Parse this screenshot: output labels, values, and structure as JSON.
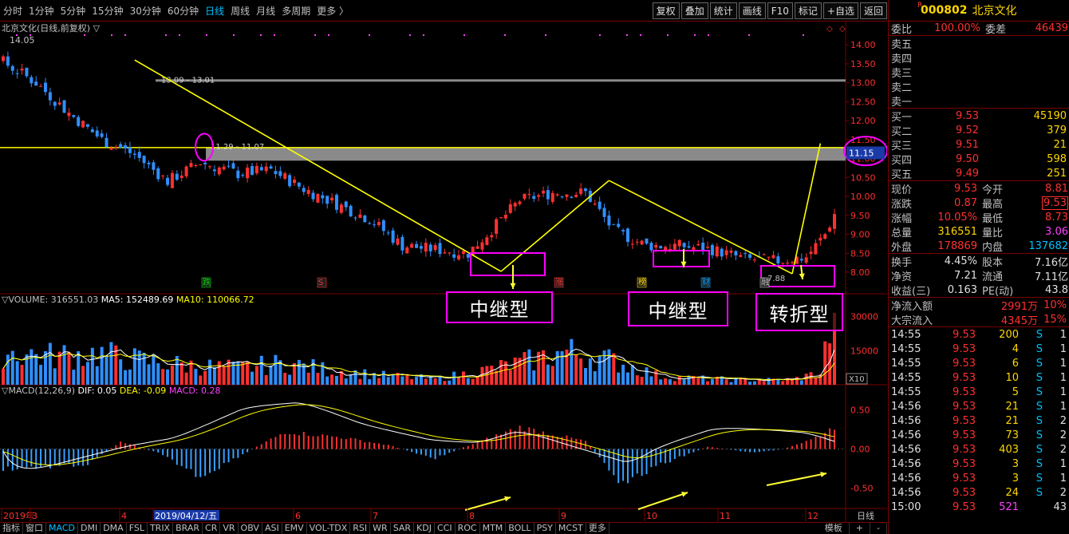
{
  "topbar": {
    "periods": [
      "分时",
      "1分钟",
      "5分钟",
      "15分钟",
      "30分钟",
      "60分钟",
      "日线",
      "周线",
      "月线",
      "多周期",
      "更多 〉"
    ],
    "active_period": "日线",
    "tools": [
      "复权",
      "叠加",
      "统计",
      "画线",
      "F10",
      "标记",
      "+自选",
      "返回"
    ]
  },
  "chart": {
    "header_text": "北京文化(日线,前复权) ▽",
    "high_label": "14.05",
    "low_label": "7.88",
    "y_axis_ticks": [
      "14.00",
      "13.50",
      "13.00",
      "12.50",
      "12.00",
      "11.50",
      "11.00",
      "10.50",
      "10.00",
      "9.50",
      "9.00",
      "8.50",
      "8.00"
    ],
    "current_price_tag": "11.15",
    "zone1_label": "13.09 - 13.01",
    "zone2_label": "11.29 - 11.07",
    "event_markers": [
      {
        "label": "跌",
        "color": "#00d000"
      },
      {
        "label": "S",
        "color": "#ff3030"
      },
      {
        "label": "涨",
        "color": "#ff3030"
      },
      {
        "label": "榜",
        "color": "#ffd700"
      },
      {
        "label": "财",
        "color": "#00a0ff"
      },
      {
        "label": "融",
        "color": "#c0c0c0"
      }
    ],
    "diamond_markers": [
      "◇",
      "◇"
    ],
    "annotations": [
      "中继型",
      "中继型",
      "转折型"
    ]
  },
  "volume": {
    "header": "VOLUME: 316551.03",
    "ma5": "MA5: 152489.69",
    "ma10": "MA10: 110066.72",
    "y_axis_ticks": [
      "30000",
      "15000"
    ],
    "unit_tag": "X10"
  },
  "macd": {
    "header": "MACD(12,26,9)",
    "dif": "DIF: 0.05",
    "dea": "DEA: -0.09",
    "macd": "MACD: 0.28",
    "y_axis_ticks": [
      "0.50",
      "0.00",
      "-0.50"
    ]
  },
  "x_axis": {
    "labels": [
      "2019年",
      "3",
      "4",
      "2019/04/12/五",
      "6",
      "7",
      "8",
      "9",
      "10",
      "11",
      "12"
    ],
    "period_label": "日线"
  },
  "bottom_tabs": {
    "items": [
      "指标",
      "窗口",
      "MACD",
      "DMI",
      "DMA",
      "FSL",
      "TRIX",
      "BRAR",
      "CR",
      "VR",
      "OBV",
      "ASI",
      "EMV",
      "VOL-TDX",
      "RSI",
      "WR",
      "SAR",
      "KDJ",
      "CCI",
      "ROC",
      "MTM",
      "BOLL",
      "PSY",
      "MCST",
      "更多"
    ],
    "active": "MACD",
    "right_items": [
      "模板",
      "+",
      "-"
    ]
  },
  "panel": {
    "flag": "R",
    "code": "000802",
    "name": "北京文化",
    "weibi_label": "委比",
    "weibi_value": "100.00%",
    "weicha_label": "委差",
    "weicha_value": "46439",
    "asks": [
      {
        "label": "卖五",
        "price": "",
        "vol": ""
      },
      {
        "label": "卖四",
        "price": "",
        "vol": ""
      },
      {
        "label": "卖三",
        "price": "",
        "vol": ""
      },
      {
        "label": "卖二",
        "price": "",
        "vol": ""
      },
      {
        "label": "卖一",
        "price": "",
        "vol": ""
      }
    ],
    "bids": [
      {
        "label": "买一",
        "price": "9.53",
        "vol": "45190"
      },
      {
        "label": "买二",
        "price": "9.52",
        "vol": "379"
      },
      {
        "label": "买三",
        "price": "9.51",
        "vol": "21"
      },
      {
        "label": "买四",
        "price": "9.50",
        "vol": "598"
      },
      {
        "label": "买五",
        "price": "9.49",
        "vol": "251"
      }
    ],
    "stats": [
      {
        "l1": "现价",
        "v1": "9.53",
        "c1": "red",
        "l2": "今开",
        "v2": "8.81",
        "c2": "red"
      },
      {
        "l1": "涨跌",
        "v1": "0.87",
        "c1": "red",
        "l2": "最高",
        "v2": "9.53",
        "c2": "red"
      },
      {
        "l1": "涨幅",
        "v1": "10.05%",
        "c1": "red",
        "l2": "最低",
        "v2": "8.73",
        "c2": "red"
      },
      {
        "l1": "总量",
        "v1": "316551",
        "c1": "yel",
        "l2": "量比",
        "v2": "3.06",
        "c2": "mag"
      },
      {
        "l1": "外盘",
        "v1": "178869",
        "c1": "red",
        "l2": "内盘",
        "v2": "137682",
        "c2": "cyan"
      }
    ],
    "stats2": [
      {
        "l1": "换手",
        "v1": "4.45%",
        "l2": "股本",
        "v2": "7.16亿"
      },
      {
        "l1": "净资",
        "v1": "7.21",
        "l2": "流通",
        "v2": "7.11亿"
      },
      {
        "l1": "收益(三)",
        "v1": "0.163",
        "l2": "PE(动)",
        "v2": "43.8"
      }
    ],
    "flows": [
      {
        "label": "净流入额",
        "value": "2991万",
        "pct": "10%"
      },
      {
        "label": "大宗流入",
        "value": "4345万",
        "pct": "15%"
      }
    ],
    "ticks": [
      {
        "time": "14:55",
        "price": "9.53",
        "vol": "200",
        "vc": "yel",
        "side": "S",
        "n": "1"
      },
      {
        "time": "14:55",
        "price": "9.53",
        "vol": "4",
        "vc": "yel",
        "side": "S",
        "n": "1"
      },
      {
        "time": "14:55",
        "price": "9.53",
        "vol": "6",
        "vc": "yel",
        "side": "S",
        "n": "1"
      },
      {
        "time": "14:55",
        "price": "9.53",
        "vol": "10",
        "vc": "yel",
        "side": "S",
        "n": "1"
      },
      {
        "time": "14:55",
        "price": "9.53",
        "vol": "5",
        "vc": "yel",
        "side": "S",
        "n": "1"
      },
      {
        "time": "14:56",
        "price": "9.53",
        "vol": "21",
        "vc": "yel",
        "side": "S",
        "n": "1"
      },
      {
        "time": "14:56",
        "price": "9.53",
        "vol": "21",
        "vc": "yel",
        "side": "S",
        "n": "2"
      },
      {
        "time": "14:56",
        "price": "9.53",
        "vol": "73",
        "vc": "yel",
        "side": "S",
        "n": "2"
      },
      {
        "time": "14:56",
        "price": "9.53",
        "vol": "403",
        "vc": "yel",
        "side": "S",
        "n": "2"
      },
      {
        "time": "14:56",
        "price": "9.53",
        "vol": "3",
        "vc": "yel",
        "side": "S",
        "n": "1"
      },
      {
        "time": "14:56",
        "price": "9.53",
        "vol": "3",
        "vc": "yel",
        "side": "S",
        "n": "1"
      },
      {
        "time": "14:56",
        "price": "9.53",
        "vol": "24",
        "vc": "yel",
        "side": "S",
        "n": "2"
      },
      {
        "time": "15:00",
        "price": "9.53",
        "vol": "521",
        "vc": "mag",
        "side": "",
        "n": "43"
      }
    ]
  },
  "chart_data": {
    "type": "candlestick",
    "colors": {
      "up": "#ff3030",
      "down": "#2f8fff",
      "ma5": "#ffffff",
      "ma10": "#ffff00",
      "trendline": "#ffff00",
      "highlight": "#ff00ff"
    },
    "price_range": [
      7.6,
      14.3
    ],
    "volume_range": [
      0,
      33000
    ],
    "macd_range": [
      -0.72,
      0.72
    ],
    "trend_path": [
      [
        0,
        13.55
      ],
      [
        7,
        13.0
      ],
      [
        14,
        12.2
      ],
      [
        21,
        11.5
      ],
      [
        28,
        11.1
      ],
      [
        35,
        10.4
      ],
      [
        42,
        10.9
      ],
      [
        50,
        10.6
      ],
      [
        57,
        10.7
      ],
      [
        64,
        10.2
      ],
      [
        71,
        9.8
      ],
      [
        78,
        9.4
      ],
      [
        85,
        8.7
      ],
      [
        92,
        8.6
      ],
      [
        99,
        8.5
      ],
      [
        103,
        9.0
      ],
      [
        110,
        9.9
      ],
      [
        117,
        10.1
      ],
      [
        124,
        10.1
      ],
      [
        130,
        9.1
      ],
      [
        137,
        8.7
      ],
      [
        144,
        8.7
      ],
      [
        151,
        8.6
      ],
      [
        158,
        8.35
      ],
      [
        165,
        8.3
      ],
      [
        171,
        8.4
      ],
      [
        175,
        9.0
      ],
      [
        177,
        9.53
      ]
    ],
    "macd_hist_path": [
      [
        0,
        -0.25
      ],
      [
        18,
        -0.2
      ],
      [
        25,
        0.1
      ],
      [
        33,
        -0.05
      ],
      [
        42,
        -0.35
      ],
      [
        50,
        -0.1
      ],
      [
        60,
        0.22
      ],
      [
        72,
        0.15
      ],
      [
        82,
        0.05
      ],
      [
        92,
        -0.12
      ],
      [
        98,
        0.02
      ],
      [
        110,
        0.28
      ],
      [
        124,
        0.1
      ],
      [
        132,
        -0.45
      ],
      [
        140,
        -0.2
      ],
      [
        150,
        0.03
      ],
      [
        160,
        -0.05
      ],
      [
        166,
        0.0
      ],
      [
        172,
        0.12
      ],
      [
        177,
        0.28
      ]
    ],
    "vol_path": [
      [
        0,
        14000
      ],
      [
        10,
        12000
      ],
      [
        20,
        13000
      ],
      [
        30,
        10000
      ],
      [
        40,
        8000
      ],
      [
        50,
        7000
      ],
      [
        60,
        9000
      ],
      [
        70,
        6000
      ],
      [
        80,
        4000
      ],
      [
        92,
        2500
      ],
      [
        100,
        5000
      ],
      [
        110,
        9000
      ],
      [
        120,
        14000
      ],
      [
        130,
        10000
      ],
      [
        140,
        3500
      ],
      [
        150,
        2500
      ],
      [
        160,
        2000
      ],
      [
        168,
        2200
      ],
      [
        174,
        5000
      ],
      [
        177,
        31655
      ]
    ],
    "hlines": [
      13.05,
      11.18,
      11.5
    ],
    "trendlines": [
      [
        [
          28,
          13.6
        ],
        [
          106,
          8.02
        ]
      ],
      [
        [
          106,
          8.02
        ],
        [
          129,
          10.42
        ]
      ],
      [
        [
          129,
          10.42
        ],
        [
          168,
          7.96
        ]
      ],
      [
        [
          168,
          7.96
        ],
        [
          174,
          11.4
        ]
      ]
    ]
  }
}
